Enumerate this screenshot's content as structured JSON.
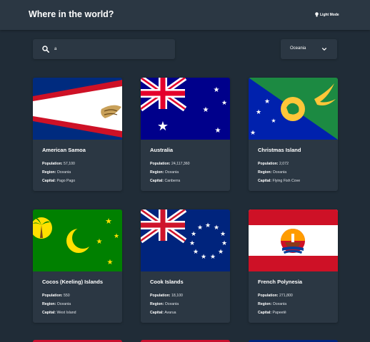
{
  "header": {
    "title": "Where in the world?",
    "mode_label": "Light Mode"
  },
  "search": {
    "value": "a",
    "icon": "search-icon"
  },
  "filter": {
    "selected": "Oceania",
    "icon": "chevron-down-icon"
  },
  "labels": {
    "population": "Population:",
    "region": "Region:",
    "capital": "Capital:"
  },
  "countries": [
    {
      "name": "American Samoa",
      "population": "57,100",
      "region": "Oceania",
      "capital": "Pago Pago"
    },
    {
      "name": "Australia",
      "population": "24,117,360",
      "region": "Oceania",
      "capital": "Canberra"
    },
    {
      "name": "Christmas Island",
      "population": "2,072",
      "region": "Oceania",
      "capital": "Flying Fish Cove"
    },
    {
      "name": "Cocos (Keeling) Islands",
      "population": "550",
      "region": "Oceania",
      "capital": "West Island"
    },
    {
      "name": "Cook Islands",
      "population": "18,100",
      "region": "Oceania",
      "capital": "Avarua"
    },
    {
      "name": "French Polynesia",
      "population": "271,800",
      "region": "Oceania",
      "capital": "Papeetē"
    }
  ],
  "colors": {
    "background": "#202c37",
    "surface": "#2b3743",
    "text": "#ffffff"
  }
}
